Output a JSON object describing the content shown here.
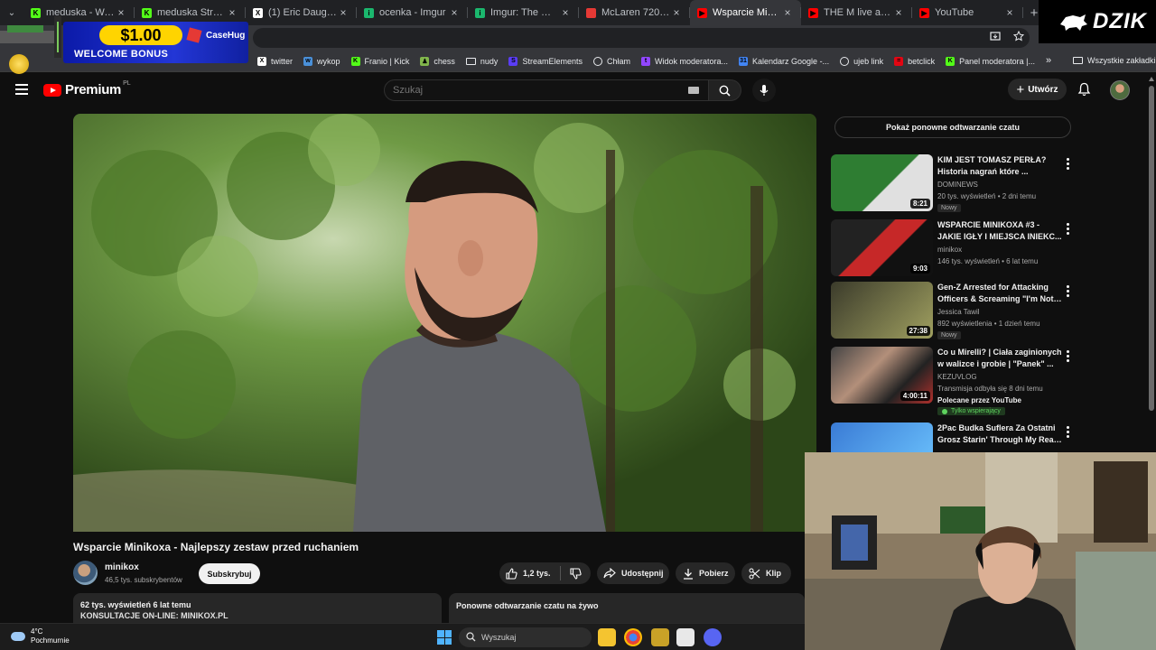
{
  "browser": {
    "tabs": [
      {
        "title": "meduska - Watch clip",
        "color": "#53fc18",
        "letter": "K",
        "active": false
      },
      {
        "title": "meduska Stream - W",
        "color": "#53fc18",
        "letter": "K",
        "active": false
      },
      {
        "title": "(1) Eric Daugherty w",
        "color": "#ffffff",
        "letter": "X",
        "active": false
      },
      {
        "title": "ocenka - Imgur",
        "color": "#1bb76e",
        "letter": "i",
        "active": false
      },
      {
        "title": "Imgur: The magic of t",
        "color": "#1bb76e",
        "letter": "i",
        "active": false
      },
      {
        "title": "McLaren 720S Coupe",
        "color": "#e53935",
        "letter": "",
        "active": false
      },
      {
        "title": "Wsparcie Minikoxa -",
        "color": "#ff0000",
        "letter": "▶",
        "active": true
      },
      {
        "title": "THE M live at FESTIV",
        "color": "#ff0000",
        "letter": "▶",
        "active": false
      },
      {
        "title": "YouTube",
        "color": "#ff0000",
        "letter": "▶",
        "active": false
      }
    ],
    "tab_close_glyph": "×",
    "new_tab_glyph": "+",
    "tab_search_glyph": "⌄",
    "bookmarks": [
      {
        "label": "twitter",
        "color": "#ffffff",
        "letter": "X"
      },
      {
        "label": "wykop",
        "color": "#4a90d9",
        "letter": "w"
      },
      {
        "label": "Franio | Kick",
        "color": "#53fc18",
        "letter": "K"
      },
      {
        "label": "chess",
        "color": "#81b64c",
        "letter": "♟"
      },
      {
        "label": "nudy",
        "color": "folder",
        "letter": ""
      },
      {
        "label": "StreamElements",
        "color": "#5a3df5",
        "letter": "S"
      },
      {
        "label": "Chłam",
        "color": "globe",
        "letter": ""
      },
      {
        "label": "Widok moderatora...",
        "color": "#9146ff",
        "letter": "t"
      },
      {
        "label": "Kalendarz Google -...",
        "color": "#4285f4",
        "letter": "31"
      },
      {
        "label": "ujeb link",
        "color": "globe",
        "letter": ""
      },
      {
        "label": "betclick",
        "color": "#e30613",
        "letter": "="
      },
      {
        "label": "Panel moderatora |...",
        "color": "#53fc18",
        "letter": "K"
      }
    ],
    "bookmarks_more": "»",
    "all_bookmarks": "Wszystkie zakładki"
  },
  "ad": {
    "amount": "$1.00",
    "bonus": "WELCOME BONUS",
    "brand": "CaseHug"
  },
  "watermark": "DZIK",
  "youtube": {
    "logo": "Premium",
    "logo_region": "PL",
    "search_placeholder": "Szukaj",
    "create_label": "Utwórz",
    "create_glyph": "+"
  },
  "video": {
    "title": "Wsparcie Minikoxa - Najlepszy zestaw przed ruchaniem",
    "channel": "minikox",
    "subscribers": "46,5 tys. subskrybentów",
    "subscribe_label": "Subskrybuj",
    "likes": "1,2 tys.",
    "share_label": "Udostępnij",
    "download_label": "Pobierz",
    "clip_label": "Klip",
    "views_line": "62 tys. wyświetleń  6 lat temu",
    "desc_line": "KONSULTACJE ON-LINE: MINIKOX.PL",
    "replay_label": "Ponowne odtwarzanie czatu na żywo"
  },
  "sidebar": {
    "replay_chat_button": "Pokaż ponowne odtwarzanie czatu",
    "items": [
      {
        "title1": "KIM JEST TOMASZ PERŁA?",
        "title2": "Historia nagrań które ...",
        "channel": "DOMINEWS",
        "meta": "20 tys. wyświetleń • 2 dni temu",
        "badge": "Nowy",
        "duration": "8:21"
      },
      {
        "title1": "WSPARCIE MINIKOXA #3 -",
        "title2": "JAKIE IGŁY I MIEJSCA INIEKC...",
        "channel": "minikox",
        "meta": "146 tys. wyświetleń • 6 lat temu",
        "badge": "",
        "duration": "9:03"
      },
      {
        "title1": "Gen-Z Arrested for Attacking",
        "title2": "Officers & Screaming \"I'm Not ...",
        "channel": "Jessica Tawil",
        "meta": "892 wyświetlenia • 1 dzień temu",
        "badge": "Nowy",
        "duration": "27:38"
      },
      {
        "title1": "Co u Mirelli? | Ciała zaginionych",
        "title2": "w walizce i grobie | \"Panek\" ...",
        "channel": "KEZUVLOG",
        "meta": "Transmisja odbyła się 8 dni temu",
        "badge": "",
        "duration": "4:00:11",
        "promo": "Polecane przez YouTube",
        "members": "Tylko wspierający"
      },
      {
        "title1": "2Pac Budka Suflera Za Ostatni",
        "title2": "Grosz Starin' Through My Rear...",
        "channel": "",
        "meta": "",
        "badge": "",
        "duration": ""
      }
    ]
  },
  "taskbar": {
    "temp": "4°C",
    "weather": "Pochmurnie",
    "search_label": "Wyszukaj"
  }
}
